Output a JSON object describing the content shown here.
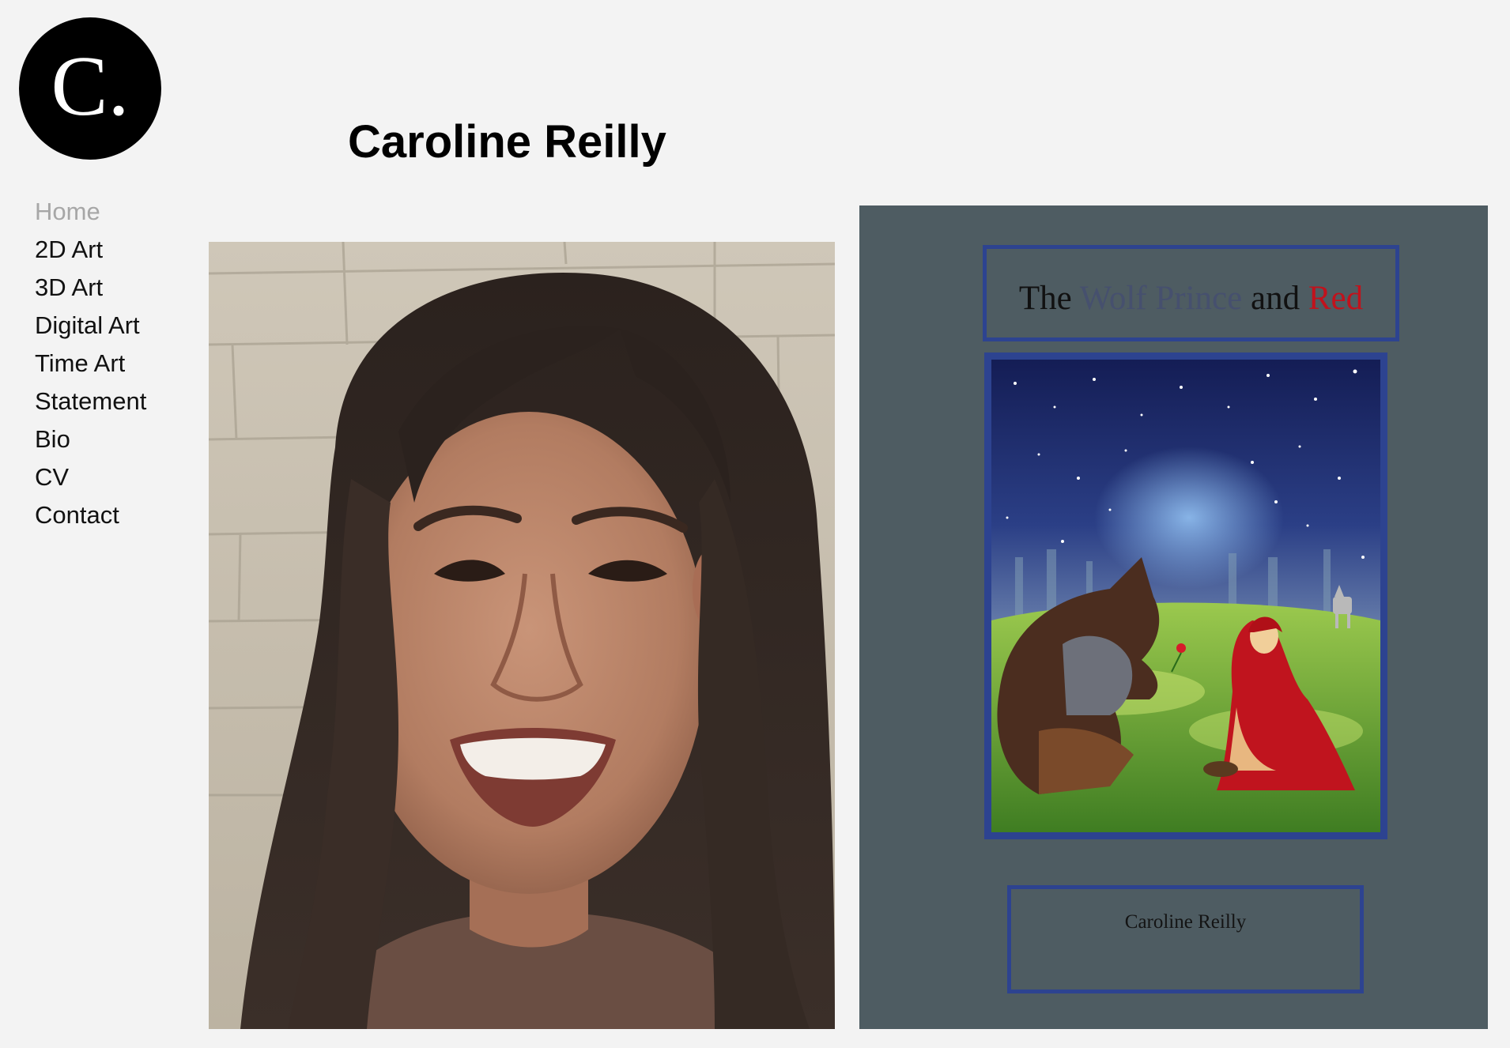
{
  "logo": {
    "text": "C."
  },
  "site": {
    "title": "Caroline Reilly"
  },
  "nav": {
    "items": [
      {
        "label": "Home",
        "active": true
      },
      {
        "label": "2D Art"
      },
      {
        "label": "3D Art"
      },
      {
        "label": "Digital Art"
      },
      {
        "label": "Time Art"
      },
      {
        "label": "Statement"
      },
      {
        "label": "Bio"
      },
      {
        "label": "CV"
      },
      {
        "label": "Contact"
      }
    ]
  },
  "book": {
    "title_words": [
      "The",
      "Wolf Prince",
      "and",
      "Red"
    ],
    "author": "Caroline Reilly"
  },
  "colors": {
    "background": "#f3f3f3",
    "nav_active": "#a7a7a7",
    "cover_bg": "#4e5c62",
    "cover_frame": "#2d4390",
    "title_red": "#c1121c"
  }
}
